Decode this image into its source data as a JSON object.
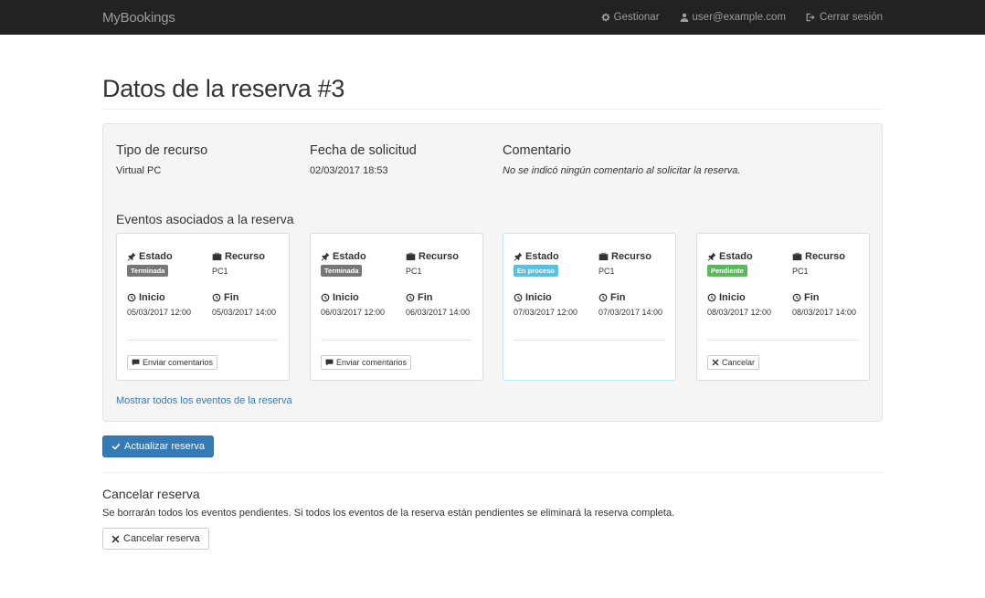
{
  "navbar": {
    "brand": "MyBookings",
    "links": [
      {
        "label": "Gestionar",
        "icon": "gear-icon"
      },
      {
        "label": "user@example.com",
        "icon": "user-icon"
      },
      {
        "label": "Cerrar sesión",
        "icon": "logout-icon"
      }
    ]
  },
  "page": {
    "title": "Datos de la reserva #3"
  },
  "info": {
    "resource_type": {
      "label": "Tipo de recurso",
      "value": "Virtual PC"
    },
    "request_date": {
      "label": "Fecha de solicitud",
      "value": "02/03/2017 18:53"
    },
    "comment": {
      "label": "Comentario",
      "value": "No se indicó ningún comentario al solicitar la reserva."
    }
  },
  "events": {
    "heading": "Eventos asociados a la reserva",
    "labels": {
      "state": "Estado",
      "resource": "Recurso",
      "start": "Inicio",
      "end": "Fin"
    },
    "items": [
      {
        "state": "Terminada",
        "state_color": "#777777",
        "resource": "PC1",
        "start": "05/03/2017 12:00",
        "end": "05/03/2017 14:00",
        "action": "Enviar comentarios",
        "action_icon": "comment-icon"
      },
      {
        "state": "Terminada",
        "state_color": "#777777",
        "resource": "PC1",
        "start": "06/03/2017 12:00",
        "end": "06/03/2017 14:00",
        "action": "Enviar comentarios",
        "action_icon": "comment-icon"
      },
      {
        "state": "En proceso",
        "state_color": "#5bc0de",
        "resource": "PC1",
        "start": "07/03/2017 12:00",
        "end": "07/03/2017 14:00",
        "action": "",
        "action_icon": ""
      },
      {
        "state": "Pendiente",
        "state_color": "#5cb85c",
        "resource": "PC1",
        "start": "08/03/2017 12:00",
        "end": "08/03/2017 14:00",
        "action": "Cancelar",
        "action_icon": "close-icon"
      }
    ],
    "show_all_link": "Mostrar todos los eventos de la reserva"
  },
  "update_button": "Actualizar reserva",
  "cancel_section": {
    "heading": "Cancelar reserva",
    "description": "Se borrarán todos los eventos pendientes. Si todos los eventos de la reserva están pendientes se eliminará la reserva completa.",
    "button": "Cancelar reserva"
  },
  "colors": {
    "navbar_bg": "#222222",
    "primary": "#337ab7",
    "link": "#337ab7"
  }
}
